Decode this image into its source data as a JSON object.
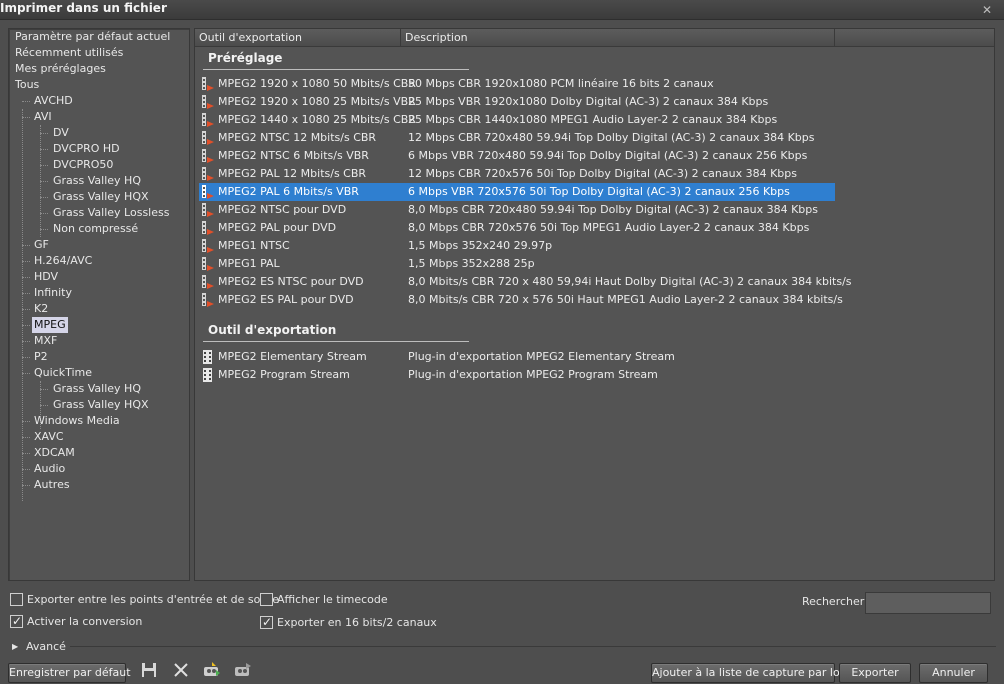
{
  "window": {
    "title": "Imprimer dans un fichier",
    "close_symbol": "✕"
  },
  "tree": {
    "items": [
      {
        "label": "Paramètre par défaut actuel"
      },
      {
        "label": "Récemment utilisés"
      },
      {
        "label": "Mes préréglages"
      },
      {
        "label": "Tous"
      },
      {
        "label": "AVCHD"
      },
      {
        "label": "AVI"
      },
      {
        "label": "DV"
      },
      {
        "label": "DVCPRO HD"
      },
      {
        "label": "DVCPRO50"
      },
      {
        "label": "Grass Valley HQ"
      },
      {
        "label": "Grass Valley HQX"
      },
      {
        "label": "Grass Valley Lossless"
      },
      {
        "label": "Non compressé"
      },
      {
        "label": "GF"
      },
      {
        "label": "H.264/AVC"
      },
      {
        "label": "HDV"
      },
      {
        "label": "Infinity"
      },
      {
        "label": "K2"
      },
      {
        "label": "MPEG",
        "selected": true
      },
      {
        "label": "MXF"
      },
      {
        "label": "P2"
      },
      {
        "label": "QuickTime"
      },
      {
        "label": "Grass Valley HQ"
      },
      {
        "label": "Grass Valley HQX"
      },
      {
        "label": "Windows Media"
      },
      {
        "label": "XAVC"
      },
      {
        "label": "XDCAM"
      },
      {
        "label": "Audio"
      },
      {
        "label": "Autres"
      }
    ]
  },
  "list": {
    "columns": [
      "Outil d'exportation",
      "Description"
    ],
    "presets_title": "Préréglage",
    "presets": [
      {
        "name": "MPEG2 1920 x 1080 50 Mbits/s CBR",
        "desc": "50 Mbps CBR 1920x1080 PCM linéaire 16 bits 2 canaux"
      },
      {
        "name": "MPEG2 1920 x 1080 25 Mbits/s VBR",
        "desc": "25 Mbps VBR 1920x1080 Dolby Digital (AC-3) 2 canaux 384 Kbps"
      },
      {
        "name": "MPEG2 1440 x 1080 25 Mbits/s CBR",
        "desc": "25 Mbps CBR 1440x1080 MPEG1 Audio Layer-2 2 canaux 384 Kbps"
      },
      {
        "name": "MPEG2 NTSC 12 Mbits/s CBR",
        "desc": "12 Mbps CBR 720x480 59.94i Top Dolby Digital (AC-3) 2 canaux 384 Kbps"
      },
      {
        "name": "MPEG2 NTSC 6 Mbits/s VBR",
        "desc": "6 Mbps VBR 720x480 59.94i Top Dolby Digital (AC-3) 2 canaux 256 Kbps"
      },
      {
        "name": "MPEG2 PAL 12 Mbits/s CBR",
        "desc": "12 Mbps CBR 720x576 50i Top Dolby Digital (AC-3) 2 canaux 384 Kbps"
      },
      {
        "name": "MPEG2 PAL 6 Mbits/s VBR",
        "desc": "6 Mbps VBR 720x576 50i Top Dolby Digital (AC-3) 2 canaux 256 Kbps",
        "selected": true
      },
      {
        "name": "MPEG2 NTSC pour DVD",
        "desc": "8,0 Mbps CBR 720x480 59.94i Top Dolby Digital (AC-3) 2 canaux 384 Kbps"
      },
      {
        "name": "MPEG2 PAL pour DVD",
        "desc": "8,0 Mbps CBR 720x576 50i Top MPEG1 Audio Layer-2 2 canaux 384 Kbps"
      },
      {
        "name": "MPEG1 NTSC",
        "desc": "1,5 Mbps 352x240 29.97p"
      },
      {
        "name": "MPEG1 PAL",
        "desc": "1,5 Mbps 352x288 25p"
      },
      {
        "name": "MPEG2 ES NTSC pour DVD",
        "desc": "8,0 Mbits/s CBR 720 x 480 59,94i Haut Dolby Digital (AC-3) 2 canaux 384 kbits/s"
      },
      {
        "name": "MPEG2 ES PAL pour DVD",
        "desc": "8,0 Mbits/s CBR 720 x 576 50i Haut MPEG1 Audio Layer-2 2 canaux 384 kbits/s"
      }
    ],
    "exporters_title": "Outil d'exportation",
    "exporters": [
      {
        "name": "MPEG2 Elementary Stream",
        "desc": "Plug-in d'exportation MPEG2 Elementary Stream"
      },
      {
        "name": "MPEG2 Program Stream",
        "desc": "Plug-in d'exportation MPEG2 Program Stream"
      }
    ]
  },
  "options": {
    "export_in_out": {
      "label": "Exporter entre les points d'entrée et de sortie",
      "checked": false
    },
    "show_timecode": {
      "label": "Afficher le timecode",
      "checked": false
    },
    "enable_conversion": {
      "label": "Activer la conversion",
      "checked": true
    },
    "export_16bit": {
      "label": "Exporter en 16 bits/2 canaux",
      "checked": true
    },
    "check_mark": "✓"
  },
  "search": {
    "label": "Rechercher",
    "value": ""
  },
  "advanced": {
    "label": "Avancé",
    "arrow": "▶"
  },
  "buttons": {
    "save_default": "Enregistrer par défaut",
    "add_batch": "Ajouter à la liste de capture par lots",
    "export": "Exporter",
    "cancel": "Annuler"
  },
  "toolbar_icons": [
    "save-preset-icon",
    "delete-preset-icon",
    "import-preset-icon",
    "export-preset-icon"
  ],
  "colors": {
    "selection": "#2f7fd0",
    "tree_selection": "#d5d5e8",
    "background": "#4e4e4e"
  }
}
